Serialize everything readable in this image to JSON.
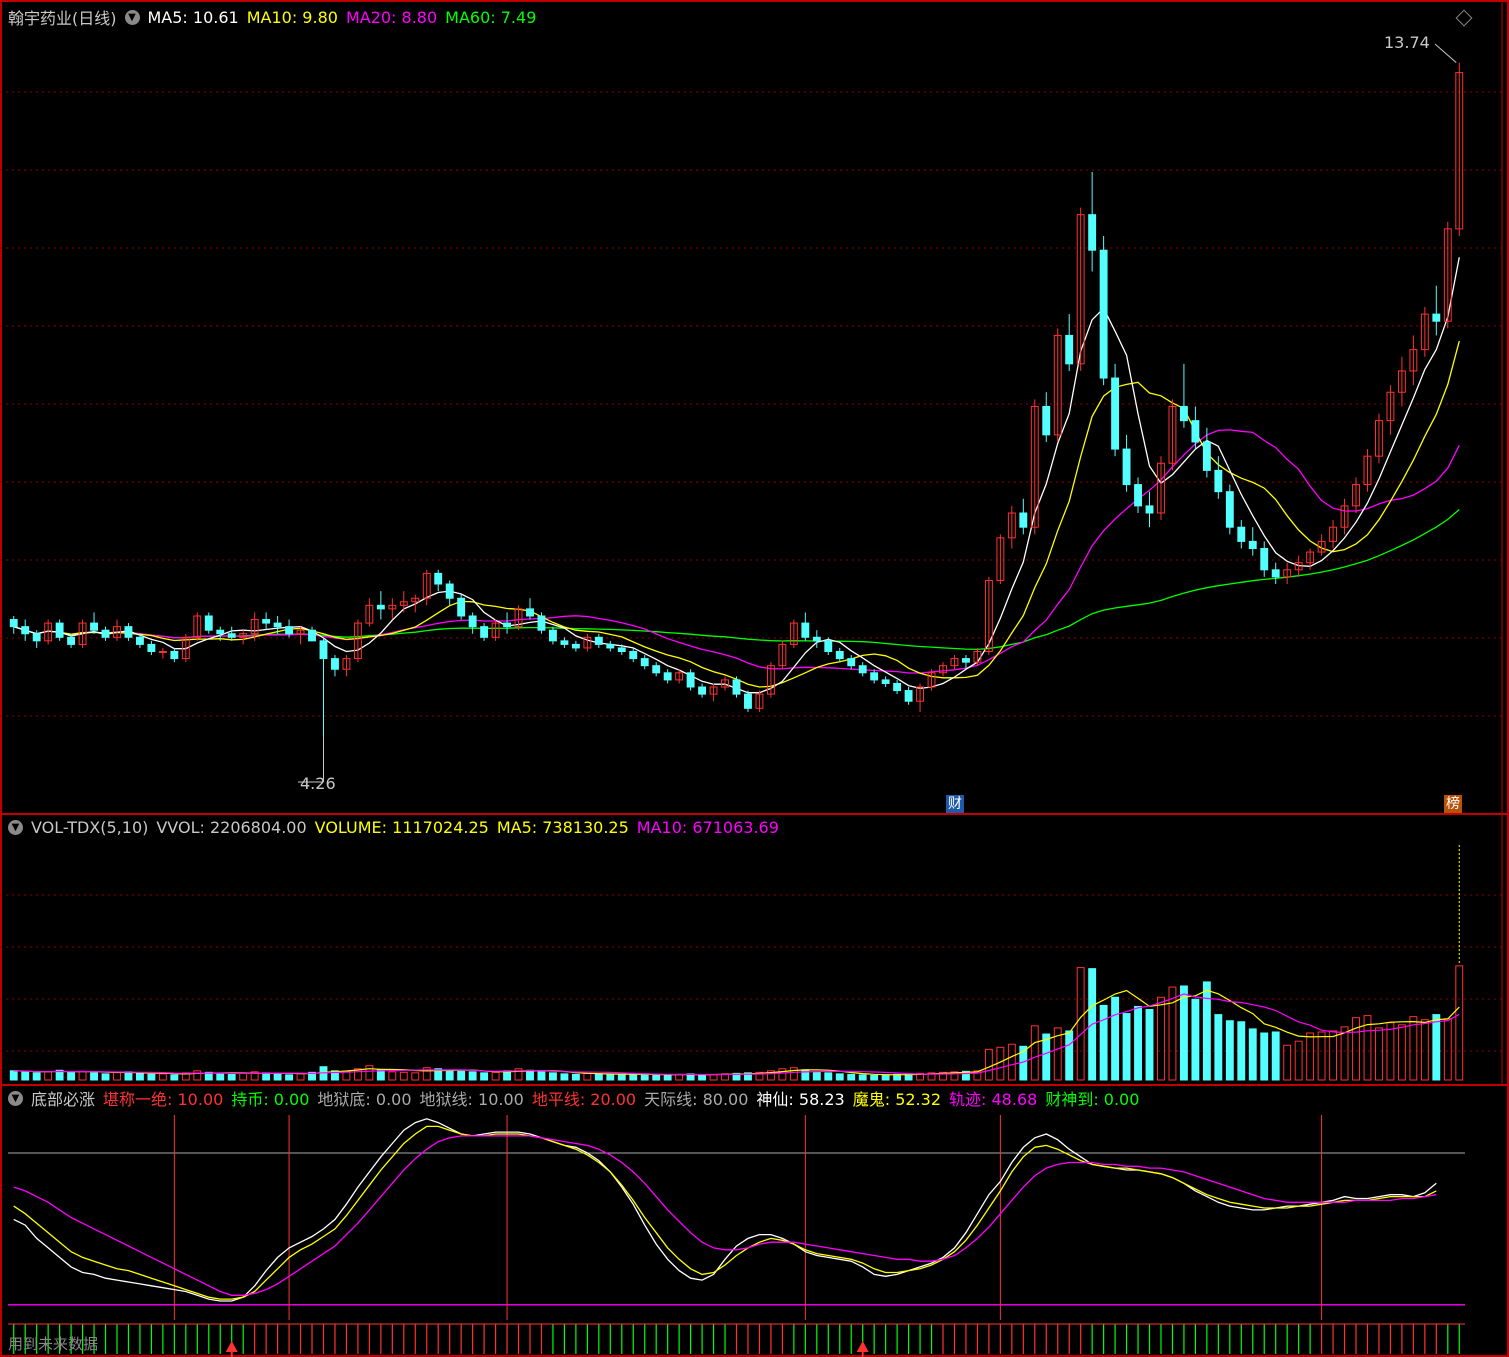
{
  "colors": {
    "up": "#ff3232",
    "down": "#54ffff",
    "ma5": "#ffffff",
    "ma10": "#ffff00",
    "ma20": "#ff00ff",
    "ma60": "#00ff00",
    "grid": "#8b0000",
    "sep": "#c00000"
  },
  "main": {
    "title": "翰宇药业(日线)",
    "ma_labels": [
      {
        "label": "MA5: 10.61",
        "color": "#ffffff"
      },
      {
        "label": "MA10: 9.80",
        "color": "#ffff00"
      },
      {
        "label": "MA20: 8.80",
        "color": "#ff00ff"
      },
      {
        "label": "MA60: 7.49",
        "color": "#00ff00"
      }
    ],
    "high_label": "13.74",
    "low_label": "4.26",
    "badge_cai": "财",
    "badge_bang": "榜"
  },
  "vol": {
    "labels": [
      {
        "label": "VOL-TDX(5,10)",
        "color": "#c8c8c8"
      },
      {
        "label": "VVOL: 2206804.00",
        "color": "#c8c8c8"
      },
      {
        "label": "VOLUME: 1117024.25",
        "color": "#ffff00"
      },
      {
        "label": "MA5: 738130.25",
        "color": "#ffff00"
      },
      {
        "label": "MA10: 671063.69",
        "color": "#ff00ff"
      }
    ]
  },
  "ind": {
    "labels": [
      {
        "label": "底部必涨",
        "color": "#c8c8c8"
      },
      {
        "label": "堪称一绝: 10.00",
        "color": "#ff3232"
      },
      {
        "label": "持币: 0.00",
        "color": "#00ff00"
      },
      {
        "label": "地狱底: 0.00",
        "color": "#aaaaaa"
      },
      {
        "label": "地狱线: 10.00",
        "color": "#aaaaaa"
      },
      {
        "label": "地平线: 20.00",
        "color": "#ff3232"
      },
      {
        "label": "天际线: 80.00",
        "color": "#aaaaaa"
      },
      {
        "label": "神仙: 58.23",
        "color": "#ffffff"
      },
      {
        "label": "魔鬼: 52.32",
        "color": "#ffff00"
      },
      {
        "label": "轨迹: 48.68",
        "color": "#ff00ff"
      },
      {
        "label": "财神到: 0.00",
        "color": "#00ff00"
      }
    ],
    "footer": "用到未来数据"
  },
  "chart_data": {
    "type": "candlestick",
    "title": "翰宇药业(日线)",
    "ylim": [
      3.5,
      14.2
    ],
    "candles": [
      [
        5.9,
        5.95,
        5.7,
        5.8
      ],
      [
        5.8,
        5.9,
        5.6,
        5.7
      ],
      [
        5.7,
        5.75,
        5.5,
        5.6
      ],
      [
        5.6,
        5.9,
        5.55,
        5.85
      ],
      [
        5.85,
        5.9,
        5.6,
        5.65
      ],
      [
        5.65,
        5.7,
        5.5,
        5.55
      ],
      [
        5.55,
        5.9,
        5.5,
        5.85
      ],
      [
        5.85,
        6.0,
        5.7,
        5.75
      ],
      [
        5.75,
        5.8,
        5.6,
        5.65
      ],
      [
        5.65,
        5.9,
        5.6,
        5.8
      ],
      [
        5.8,
        5.85,
        5.6,
        5.65
      ],
      [
        5.65,
        5.7,
        5.5,
        5.55
      ],
      [
        5.55,
        5.6,
        5.4,
        5.45
      ],
      [
        5.45,
        5.5,
        5.35,
        5.45
      ],
      [
        5.45,
        5.5,
        5.3,
        5.35
      ],
      [
        5.35,
        5.7,
        5.3,
        5.65
      ],
      [
        5.65,
        6.0,
        5.6,
        5.95
      ],
      [
        5.95,
        6.0,
        5.7,
        5.75
      ],
      [
        5.75,
        5.8,
        5.6,
        5.7
      ],
      [
        5.7,
        5.8,
        5.6,
        5.65
      ],
      [
        5.65,
        5.75,
        5.55,
        5.7
      ],
      [
        5.7,
        6.0,
        5.6,
        5.9
      ],
      [
        5.9,
        6.0,
        5.75,
        5.85
      ],
      [
        5.85,
        5.95,
        5.7,
        5.8
      ],
      [
        5.8,
        5.9,
        5.65,
        5.7
      ],
      [
        5.7,
        5.8,
        5.55,
        5.75
      ],
      [
        5.75,
        5.8,
        5.6,
        5.6
      ],
      [
        5.6,
        5.65,
        4.26,
        5.35
      ],
      [
        5.35,
        5.4,
        5.1,
        5.2
      ],
      [
        5.2,
        5.4,
        5.1,
        5.35
      ],
      [
        5.35,
        5.9,
        5.3,
        5.85
      ],
      [
        5.85,
        6.2,
        5.8,
        6.1
      ],
      [
        6.1,
        6.3,
        5.9,
        6.05
      ],
      [
        6.05,
        6.2,
        5.9,
        6.1
      ],
      [
        6.1,
        6.3,
        6.0,
        6.15
      ],
      [
        6.15,
        6.25,
        6.0,
        6.2
      ],
      [
        6.2,
        6.6,
        6.1,
        6.55
      ],
      [
        6.55,
        6.6,
        6.3,
        6.4
      ],
      [
        6.4,
        6.45,
        6.1,
        6.2
      ],
      [
        6.2,
        6.25,
        5.9,
        5.95
      ],
      [
        5.95,
        6.0,
        5.7,
        5.8
      ],
      [
        5.8,
        5.85,
        5.6,
        5.65
      ],
      [
        5.65,
        5.9,
        5.6,
        5.85
      ],
      [
        5.85,
        6.0,
        5.7,
        5.8
      ],
      [
        5.8,
        6.1,
        5.75,
        6.05
      ],
      [
        6.05,
        6.2,
        5.9,
        5.95
      ],
      [
        5.95,
        6.0,
        5.7,
        5.75
      ],
      [
        5.75,
        5.8,
        5.55,
        5.6
      ],
      [
        5.6,
        5.65,
        5.5,
        5.55
      ],
      [
        5.55,
        5.6,
        5.45,
        5.5
      ],
      [
        5.5,
        5.7,
        5.45,
        5.65
      ],
      [
        5.65,
        5.7,
        5.5,
        5.55
      ],
      [
        5.55,
        5.6,
        5.45,
        5.5
      ],
      [
        5.5,
        5.55,
        5.4,
        5.45
      ],
      [
        5.45,
        5.5,
        5.3,
        5.35
      ],
      [
        5.35,
        5.4,
        5.2,
        5.25
      ],
      [
        5.25,
        5.3,
        5.1,
        5.15
      ],
      [
        5.15,
        5.2,
        5.0,
        5.05
      ],
      [
        5.05,
        5.2,
        5.0,
        5.15
      ],
      [
        5.15,
        5.2,
        4.9,
        4.95
      ],
      [
        4.95,
        5.0,
        4.8,
        4.85
      ],
      [
        4.85,
        5.0,
        4.75,
        4.95
      ],
      [
        4.95,
        5.1,
        4.9,
        5.05
      ],
      [
        5.05,
        5.1,
        4.8,
        4.85
      ],
      [
        4.85,
        4.9,
        4.6,
        4.65
      ],
      [
        4.65,
        4.9,
        4.6,
        4.85
      ],
      [
        4.85,
        5.3,
        4.8,
        5.25
      ],
      [
        5.25,
        5.6,
        5.2,
        5.55
      ],
      [
        5.55,
        5.9,
        5.5,
        5.85
      ],
      [
        5.85,
        6.0,
        5.6,
        5.65
      ],
      [
        5.65,
        5.75,
        5.5,
        5.6
      ],
      [
        5.6,
        5.65,
        5.4,
        5.45
      ],
      [
        5.45,
        5.5,
        5.3,
        5.35
      ],
      [
        5.35,
        5.4,
        5.2,
        5.25
      ],
      [
        5.25,
        5.3,
        5.1,
        5.15
      ],
      [
        5.15,
        5.2,
        5.0,
        5.05
      ],
      [
        5.05,
        5.1,
        4.95,
        5.0
      ],
      [
        5.0,
        5.05,
        4.85,
        4.9
      ],
      [
        4.9,
        4.95,
        4.7,
        4.75
      ],
      [
        4.75,
        5.0,
        4.6,
        4.95
      ],
      [
        4.95,
        5.2,
        4.9,
        5.15
      ],
      [
        5.15,
        5.3,
        5.1,
        5.25
      ],
      [
        5.25,
        5.4,
        5.2,
        5.35
      ],
      [
        5.35,
        5.4,
        5.2,
        5.3
      ],
      [
        5.3,
        5.5,
        5.25,
        5.45
      ],
      [
        5.45,
        6.5,
        5.4,
        6.45
      ],
      [
        6.45,
        7.1,
        6.4,
        7.05
      ],
      [
        7.05,
        7.5,
        6.9,
        7.4
      ],
      [
        7.4,
        7.6,
        7.1,
        7.2
      ],
      [
        7.2,
        9.0,
        7.1,
        8.9
      ],
      [
        8.9,
        9.1,
        8.4,
        8.5
      ],
      [
        8.5,
        10.0,
        8.4,
        9.9
      ],
      [
        9.9,
        10.2,
        9.4,
        9.5
      ],
      [
        9.5,
        11.7,
        9.4,
        11.6
      ],
      [
        11.6,
        12.2,
        10.8,
        11.1
      ],
      [
        11.1,
        11.3,
        9.2,
        9.3
      ],
      [
        9.3,
        9.5,
        8.2,
        8.3
      ],
      [
        8.3,
        8.5,
        7.7,
        7.8
      ],
      [
        7.8,
        7.9,
        7.4,
        7.5
      ],
      [
        7.5,
        7.7,
        7.2,
        7.4
      ],
      [
        7.4,
        8.2,
        7.3,
        8.1
      ],
      [
        8.1,
        9.0,
        8.0,
        8.9
      ],
      [
        8.9,
        9.5,
        8.6,
        8.7
      ],
      [
        8.7,
        8.9,
        8.3,
        8.4
      ],
      [
        8.4,
        8.6,
        7.9,
        8.0
      ],
      [
        8.0,
        8.2,
        7.6,
        7.7
      ],
      [
        7.7,
        7.8,
        7.1,
        7.2
      ],
      [
        7.2,
        7.3,
        6.9,
        7.0
      ],
      [
        7.0,
        7.2,
        6.8,
        6.9
      ],
      [
        6.9,
        7.0,
        6.5,
        6.6
      ],
      [
        6.6,
        6.7,
        6.4,
        6.5
      ],
      [
        6.5,
        6.7,
        6.4,
        6.6
      ],
      [
        6.6,
        6.8,
        6.5,
        6.7
      ],
      [
        6.7,
        6.9,
        6.6,
        6.85
      ],
      [
        6.85,
        7.1,
        6.8,
        7.0
      ],
      [
        7.0,
        7.3,
        6.9,
        7.2
      ],
      [
        7.2,
        7.6,
        7.1,
        7.5
      ],
      [
        7.5,
        7.9,
        7.4,
        7.8
      ],
      [
        7.8,
        8.3,
        7.7,
        8.2
      ],
      [
        8.2,
        8.8,
        8.1,
        8.7
      ],
      [
        8.7,
        9.2,
        8.5,
        9.1
      ],
      [
        9.1,
        9.6,
        8.9,
        9.4
      ],
      [
        9.4,
        9.9,
        9.2,
        9.7
      ],
      [
        9.7,
        10.3,
        9.6,
        10.2
      ],
      [
        10.2,
        10.6,
        9.9,
        10.1
      ],
      [
        10.1,
        11.5,
        10.0,
        11.4
      ],
      [
        11.4,
        13.74,
        11.3,
        13.6
      ]
    ],
    "vol_ylim": [
      0,
      2300000
    ],
    "vol_ma5": 738130.25,
    "vol_ma10": 671063.69,
    "volume": [
      90000,
      85000,
      70000,
      80000,
      95000,
      75000,
      85000,
      70000,
      60000,
      75000,
      80000,
      65000,
      55000,
      60000,
      50000,
      70000,
      90000,
      75000,
      60000,
      55000,
      65000,
      80000,
      70000,
      60000,
      50000,
      60000,
      75000,
      130000,
      90000,
      85000,
      110000,
      140000,
      100000,
      80000,
      75000,
      70000,
      120000,
      110000,
      95000,
      85000,
      80000,
      70000,
      75000,
      90000,
      110000,
      95000,
      80000,
      70000,
      60000,
      55000,
      65000,
      60000,
      55000,
      50000,
      55000,
      60000,
      50000,
      45000,
      55000,
      60000,
      50000,
      55000,
      60000,
      65000,
      70000,
      75000,
      90000,
      110000,
      120000,
      100000,
      80000,
      70000,
      60000,
      55000,
      50000,
      45000,
      50000,
      55000,
      60000,
      65000,
      70000,
      75000,
      80000,
      85000,
      90000,
      300000,
      320000,
      350000,
      330000,
      530000,
      450000,
      510000,
      480000,
      1100000,
      1090000,
      730000,
      810000,
      650000,
      720000,
      690000,
      810000,
      910000,
      920000,
      790000,
      960000,
      640000,
      580000,
      570000,
      500000,
      460000,
      470000,
      340000,
      380000,
      460000,
      470000,
      480000,
      520000,
      610000,
      630000,
      510000,
      560000,
      540000,
      620000,
      590000,
      640000,
      600000,
      1117024.25
    ],
    "osc_ylim": [
      -8,
      100
    ],
    "series": [
      {
        "name": "神仙",
        "values": [
          45,
          42,
          35,
          30,
          25,
          20,
          17,
          16,
          14,
          13,
          12,
          11,
          10,
          9,
          8,
          7,
          5,
          3,
          2,
          2,
          4,
          10,
          18,
          25,
          30,
          33,
          36,
          40,
          45,
          53,
          62,
          70,
          78,
          85,
          92,
          96,
          98,
          96,
          93,
          90,
          89,
          90,
          91,
          91,
          91,
          90,
          88,
          86,
          84,
          83,
          80,
          76,
          70,
          62,
          53,
          42,
          32,
          24,
          18,
          14,
          13,
          16,
          24,
          31,
          35,
          37,
          37,
          35,
          32,
          28,
          26,
          25,
          24,
          23,
          20,
          16,
          15,
          16,
          18,
          20,
          22,
          25,
          30,
          38,
          48,
          58,
          65,
          75,
          83,
          88,
          90,
          87,
          82,
          78,
          74,
          73,
          72,
          71,
          71,
          70,
          69,
          67,
          64,
          60,
          57,
          54,
          52,
          51,
          50,
          50,
          51,
          52,
          52,
          53,
          54,
          55,
          57,
          56,
          56,
          57,
          58,
          58,
          57,
          59,
          64
        ],
        "color": "#ffffff"
      },
      {
        "name": "魔鬼",
        "values": [
          52,
          48,
          43,
          38,
          33,
          28,
          25,
          23,
          21,
          19,
          18,
          16,
          14,
          12,
          10,
          8,
          6,
          4,
          3,
          3,
          4,
          7,
          13,
          19,
          25,
          29,
          32,
          36,
          40,
          47,
          55,
          63,
          71,
          78,
          85,
          90,
          94,
          94,
          92,
          90,
          89,
          89,
          90,
          90,
          90,
          89,
          88,
          86,
          84,
          82,
          79,
          75,
          70,
          63,
          55,
          46,
          38,
          30,
          24,
          19,
          16,
          17,
          21,
          26,
          30,
          33,
          35,
          34,
          32,
          29,
          27,
          26,
          25,
          24,
          22,
          19,
          17,
          17,
          18,
          19,
          21,
          24,
          28,
          34,
          42,
          51,
          60,
          70,
          78,
          83,
          84,
          82,
          79,
          76,
          74,
          73,
          72,
          72,
          71,
          70,
          69,
          67,
          64,
          61,
          58,
          56,
          54,
          53,
          52,
          51,
          51,
          51,
          52,
          52,
          53,
          54,
          55,
          55,
          55,
          56,
          57,
          57,
          57,
          57,
          60
        ],
        "color": "#ffff00"
      },
      {
        "name": "轨迹",
        "values": [
          62,
          60,
          57,
          54,
          50,
          46,
          43,
          40,
          37,
          34,
          31,
          28,
          25,
          22,
          19,
          16,
          13,
          10,
          7,
          5,
          5,
          6,
          8,
          11,
          15,
          19,
          23,
          27,
          31,
          37,
          43,
          50,
          57,
          64,
          71,
          77,
          82,
          86,
          88,
          89,
          89,
          89,
          89,
          89,
          89,
          89,
          88,
          87,
          86,
          85,
          84,
          82,
          79,
          75,
          70,
          64,
          57,
          50,
          44,
          38,
          33,
          30,
          29,
          29,
          30,
          32,
          33,
          33,
          33,
          32,
          31,
          30,
          29,
          28,
          27,
          26,
          25,
          24,
          24,
          23,
          23,
          24,
          26,
          30,
          35,
          41,
          48,
          55,
          62,
          68,
          72,
          74,
          75,
          75,
          75,
          74,
          74,
          73,
          73,
          72,
          72,
          71,
          70,
          68,
          66,
          64,
          62,
          60,
          58,
          56,
          55,
          54,
          54,
          54,
          54,
          54,
          54,
          55,
          55,
          55,
          55,
          56,
          56,
          57,
          58
        ],
        "color": "#ff00ff"
      }
    ]
  }
}
